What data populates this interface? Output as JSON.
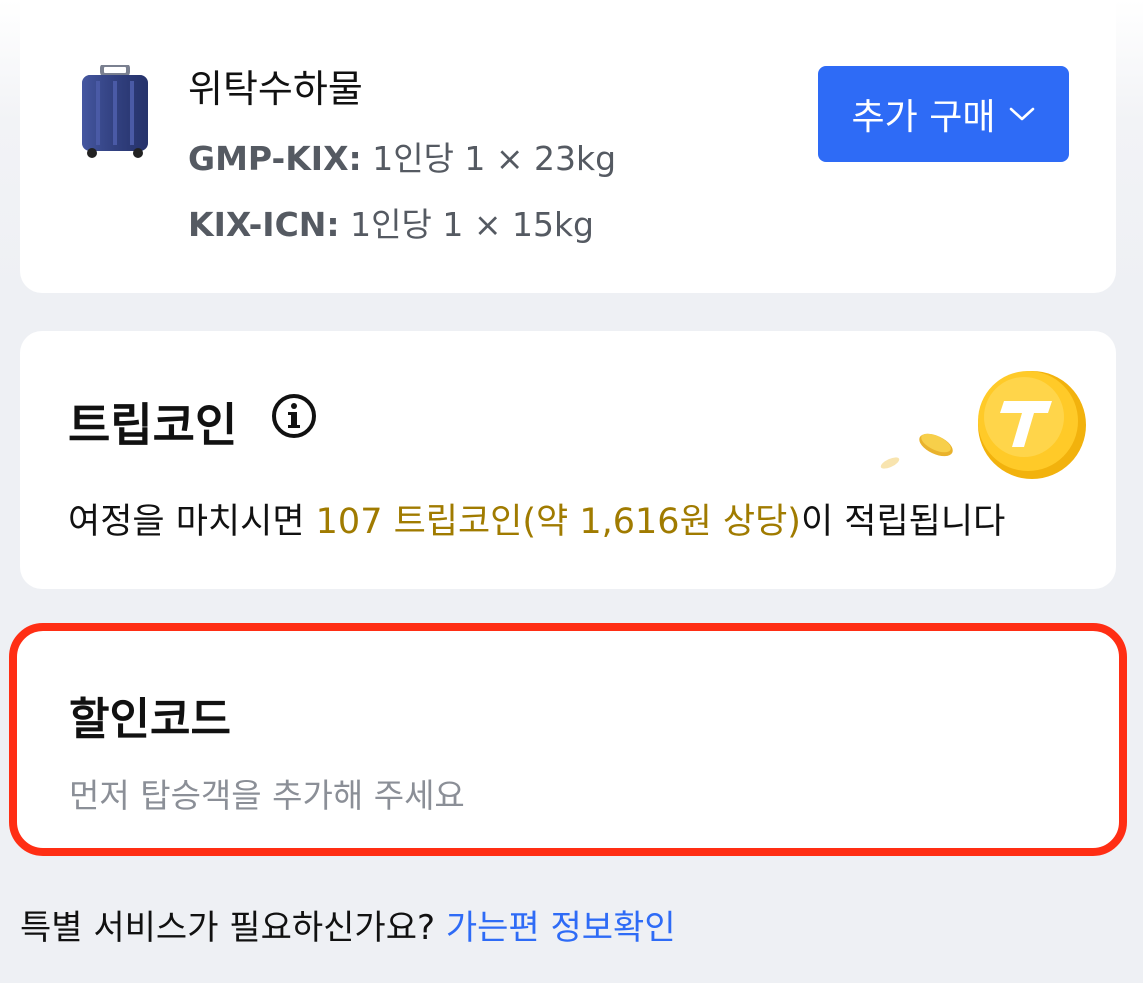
{
  "baggage": {
    "title": "위탁수하물",
    "routes": [
      {
        "code": "GMP-KIX:",
        "allowance": "1인당 1 × 23kg"
      },
      {
        "code": "KIX-ICN:",
        "allowance": "1인당 1 × 15kg"
      }
    ],
    "buy_button_label": "추가 구매",
    "icon": "suitcase-icon"
  },
  "tripcoin": {
    "title": "트립코인",
    "desc_prefix": "여정을 마치시면 ",
    "desc_highlight": "107 트립코인(약 1,616원 상당)",
    "desc_suffix": "이 적립됩니다",
    "highlight_color": "#a07b00"
  },
  "discount": {
    "title": "할인코드",
    "subtitle": "먼저 탑승객을 추가해 주세요",
    "highlight_border_color": "#ff2e14"
  },
  "footer": {
    "question": "특별 서비스가 필요하신가요?",
    "link": "가는편 정보확인"
  },
  "colors": {
    "accent": "#2e6bf6"
  }
}
